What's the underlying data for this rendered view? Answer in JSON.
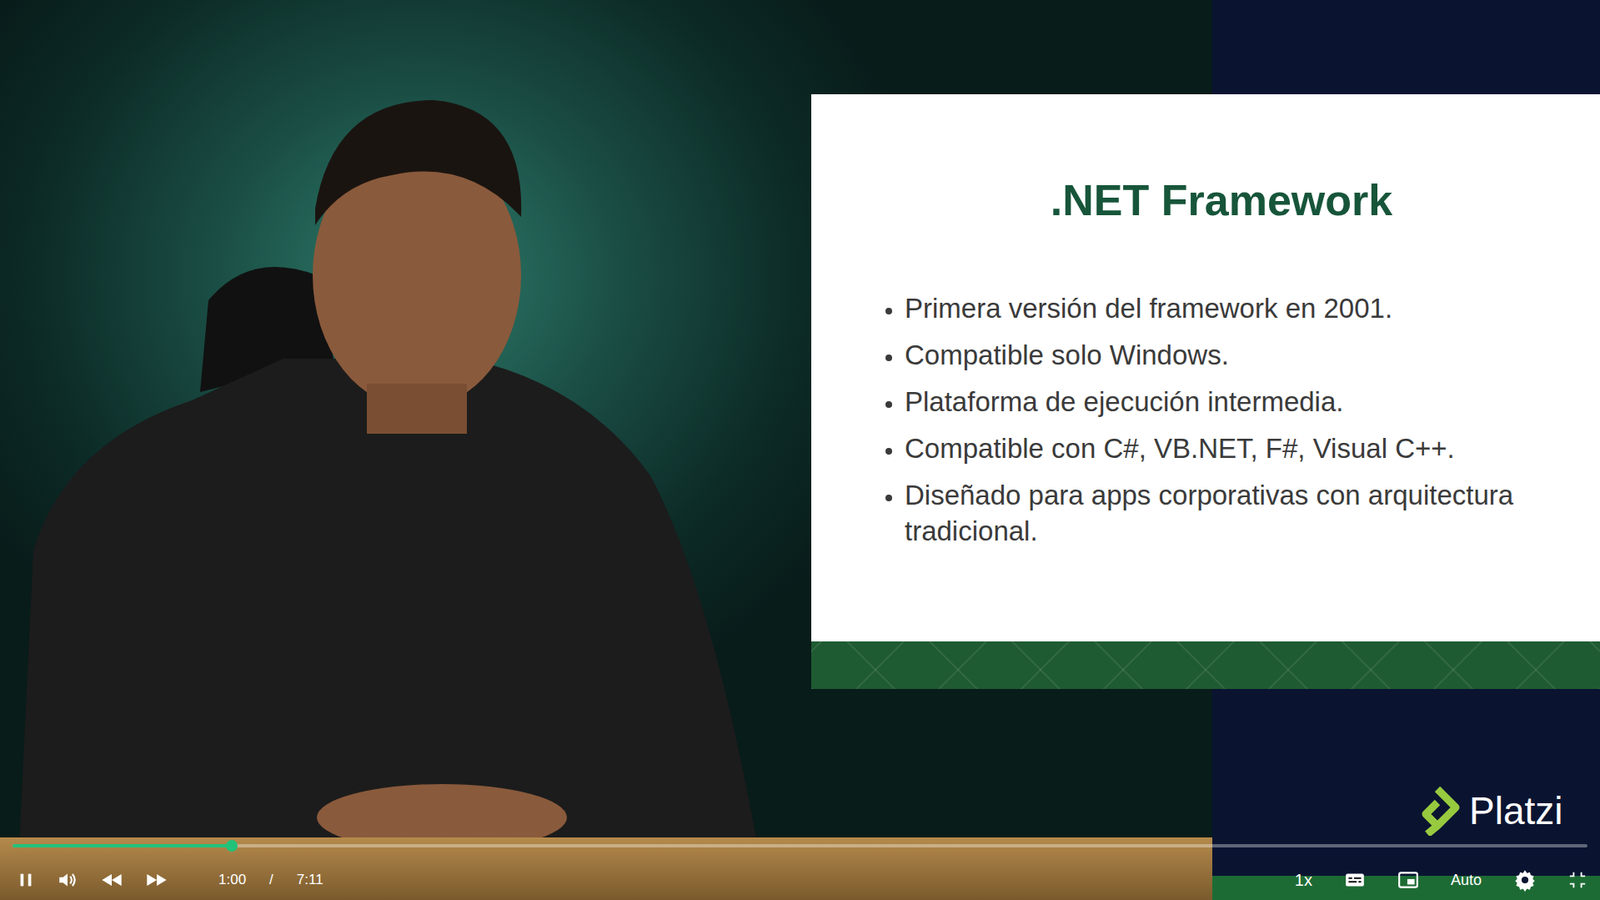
{
  "player": {
    "playing": true,
    "elapsed": "1:00",
    "separator": "/",
    "duration": "7:11",
    "level": 0.139,
    "speed": "1x",
    "quality": "Auto"
  },
  "slide": {
    "title": ".NET Framework",
    "bullets": [
      "Primera versión del framework en 2001.",
      "Compatible solo Windows.",
      "Plataforma de ejecución intermedia.",
      "Compatible con C#, VB.NET, F#, Visual C++.",
      "Diseñado para apps corporativas con arquitectura tradicional."
    ]
  },
  "watermark": {
    "brand": "Platzi"
  }
}
